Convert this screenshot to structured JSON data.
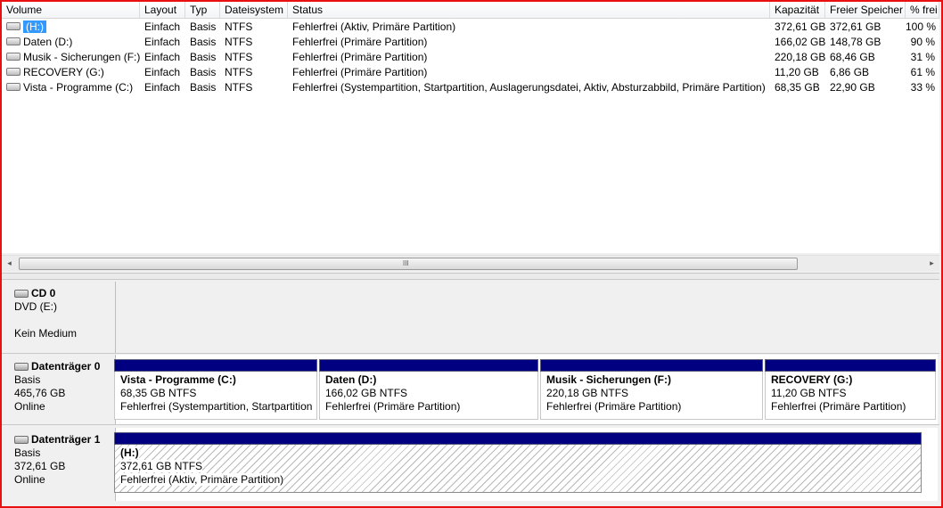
{
  "columns": [
    "Volume",
    "Layout",
    "Typ",
    "Dateisystem",
    "Status",
    "Kapazität",
    "Freier Speicher",
    "% frei"
  ],
  "volumes": [
    {
      "name": "(H:)",
      "layout": "Einfach",
      "typ": "Basis",
      "fs": "NTFS",
      "status": "Fehlerfrei (Aktiv, Primäre Partition)",
      "kap": "372,61 GB",
      "frei": "372,61 GB",
      "pct": "100 %",
      "selected": true
    },
    {
      "name": "Daten (D:)",
      "layout": "Einfach",
      "typ": "Basis",
      "fs": "NTFS",
      "status": "Fehlerfrei (Primäre Partition)",
      "kap": "166,02 GB",
      "frei": "148,78 GB",
      "pct": "90 %"
    },
    {
      "name": "Musik - Sicherungen (F:)",
      "layout": "Einfach",
      "typ": "Basis",
      "fs": "NTFS",
      "status": "Fehlerfrei (Primäre Partition)",
      "kap": "220,18 GB",
      "frei": "68,46 GB",
      "pct": "31 %"
    },
    {
      "name": "RECOVERY (G:)",
      "layout": "Einfach",
      "typ": "Basis",
      "fs": "NTFS",
      "status": "Fehlerfrei (Primäre Partition)",
      "kap": "11,20 GB",
      "frei": "6,86 GB",
      "pct": "61 %"
    },
    {
      "name": "Vista - Programme (C:)",
      "layout": "Einfach",
      "typ": "Basis",
      "fs": "NTFS",
      "status": "Fehlerfrei (Systempartition, Startpartition, Auslagerungsdatei, Aktiv, Absturzabbild, Primäre Partition)",
      "kap": "68,35 GB",
      "frei": "22,90 GB",
      "pct": "33 %"
    }
  ],
  "scroll": {
    "left": "◂",
    "right": "▸",
    "grip": "III"
  },
  "cd0": {
    "title": "CD 0",
    "line1": "DVD (E:)",
    "line2": "Kein Medium"
  },
  "disk0": {
    "title": "Datenträger 0",
    "type": "Basis",
    "size": "465,76 GB",
    "state": "Online",
    "parts": [
      {
        "name": "Vista - Programme  (C:)",
        "size": "68,35 GB NTFS",
        "status": "Fehlerfrei (Systempartition, Startpartition"
      },
      {
        "name": "Daten  (D:)",
        "size": "166,02 GB NTFS",
        "status": "Fehlerfrei (Primäre Partition)"
      },
      {
        "name": "Musik - Sicherungen  (F:)",
        "size": "220,18 GB NTFS",
        "status": "Fehlerfrei (Primäre Partition)"
      },
      {
        "name": "RECOVERY  (G:)",
        "size": "11,20 GB NTFS",
        "status": "Fehlerfrei (Primäre Partition)"
      }
    ]
  },
  "disk1": {
    "title": "Datenträger 1",
    "type": "Basis",
    "size": "372,61 GB",
    "state": "Online",
    "parts": [
      {
        "name": "(H:)",
        "size": "372,61 GB NTFS",
        "status": "Fehlerfrei (Aktiv, Primäre Partition)"
      }
    ]
  },
  "colors": {
    "partition_bar": "#000080",
    "selection": "#3399ff",
    "frame": "#e81010"
  }
}
